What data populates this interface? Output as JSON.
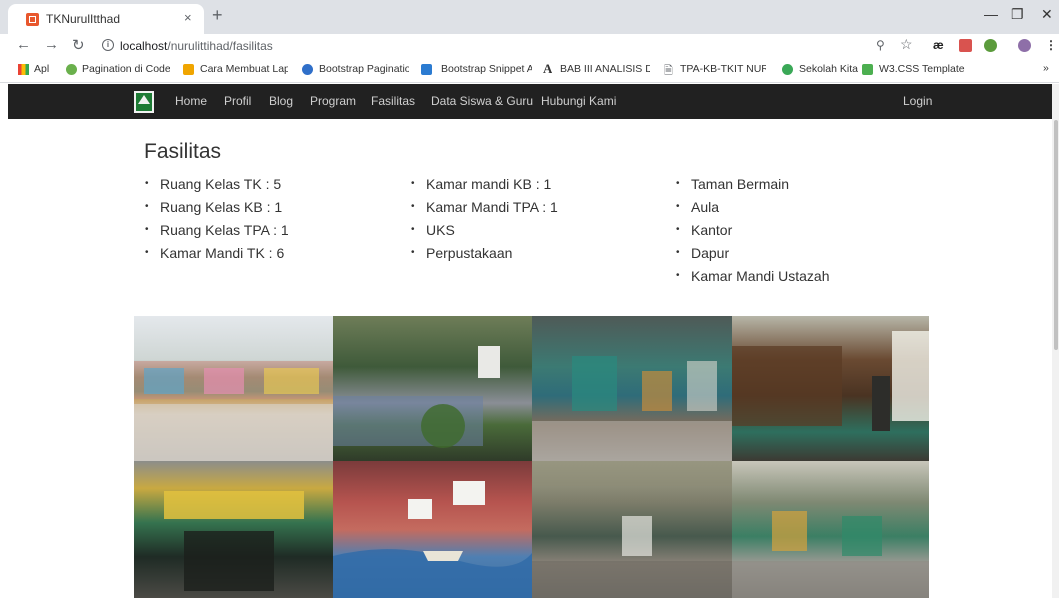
{
  "browser": {
    "tab_title": "TKNurulItthad",
    "tab_close": "×",
    "new_tab": "+",
    "url_host": "localhost",
    "url_path": "/nurulittihad/fasilitas",
    "bookmarks": [
      "Apl",
      "Pagination di Codelg",
      "Cara Membuat Lapor",
      "Bootstrap Pagination",
      "Bootstrap Snippet Ac",
      "BAB III ANALISIS DAN",
      "TPA-KB-TKIT NURUL",
      "Sekolah Kita",
      "W3.CSS Template"
    ],
    "overflow": "»",
    "ext_ae": "æ"
  },
  "navbar": {
    "items": [
      "Home",
      "Profil",
      "Blog",
      "Program",
      "Fasilitas",
      "Data Siswa & Guru",
      "Hubungi Kami"
    ],
    "login": "Login"
  },
  "page": {
    "title": "Fasilitas",
    "columns": [
      [
        "Ruang Kelas TK : 5",
        "Ruang Kelas KB : 1",
        "Ruang Kelas TPA : 1",
        "Kamar Mandi TK : 6"
      ],
      [
        "Kamar mandi KB : 1",
        "Kamar Mandi TPA : 1",
        "UKS",
        "Perpustakaan"
      ],
      [
        "Taman Bermain",
        "Aula",
        "Kantor",
        "Dapur",
        "Kamar Mandi Ustazah"
      ]
    ]
  },
  "colors": {
    "navbar_bg": "#212121",
    "tab_strip": "#dee1e6",
    "text": "#333333"
  }
}
